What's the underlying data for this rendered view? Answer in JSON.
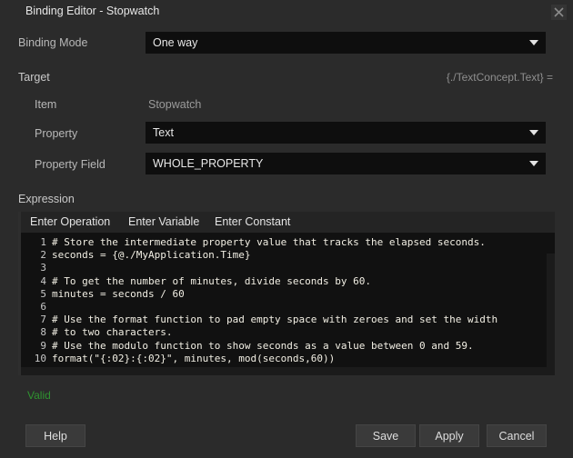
{
  "window": {
    "title": "Binding Editor - Stopwatch",
    "close_icon": "close-icon"
  },
  "binding_mode": {
    "label": "Binding Mode",
    "value": "One way"
  },
  "target": {
    "section_label": "Target",
    "path_text": "{./TextConcept.Text} =",
    "item_label": "Item",
    "item_value": "Stopwatch",
    "property_label": "Property",
    "property_value": "Text",
    "property_field_label": "Property Field",
    "property_field_value": "WHOLE_PROPERTY"
  },
  "expression": {
    "section_label": "Expression",
    "toolbar": {
      "enter_operation": "Enter Operation",
      "enter_variable": "Enter Variable",
      "enter_constant": "Enter Constant"
    },
    "lines": [
      {
        "n": "1",
        "text": "# Store the intermediate property value that tracks the elapsed seconds."
      },
      {
        "n": "2",
        "text": "seconds = {@./MyApplication.Time}"
      },
      {
        "n": "3",
        "text": ""
      },
      {
        "n": "4",
        "text": "# To get the number of minutes, divide seconds by 60."
      },
      {
        "n": "5",
        "text": "minutes = seconds / 60"
      },
      {
        "n": "6",
        "text": ""
      },
      {
        "n": "7",
        "text": "# Use the format function to pad empty space with zeroes and set the width"
      },
      {
        "n": "8",
        "text": "# to two characters."
      },
      {
        "n": "9",
        "text": "# Use the modulo function to show seconds as a value between 0 and 59."
      },
      {
        "n": "10",
        "text": "format(\"{:02}:{:02}\", minutes, mod(seconds,60))"
      }
    ],
    "status": "Valid",
    "status_color": "#2f9330"
  },
  "buttons": {
    "help": "Help",
    "save": "Save",
    "apply": "Apply",
    "cancel": "Cancel"
  }
}
